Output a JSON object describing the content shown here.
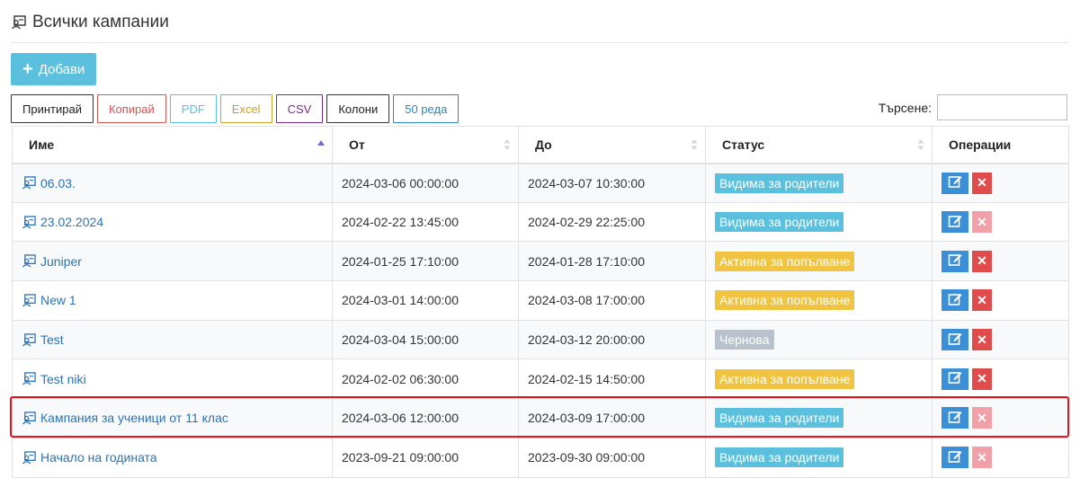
{
  "header": {
    "title": "Всички кампании"
  },
  "toolbar": {
    "add_label": "Добави",
    "buttons": [
      "Принтирай",
      "Копирай",
      "PDF",
      "Excel",
      "CSV",
      "Колони",
      "50 реда"
    ]
  },
  "search": {
    "label": "Търсене:",
    "value": ""
  },
  "table": {
    "columns": [
      "Име",
      "От",
      "До",
      "Статус",
      "Операции"
    ],
    "rows": [
      {
        "name": "06.03.",
        "from": "2024-03-06 00:00:00",
        "to": "2024-03-07 10:30:00",
        "status": "Видима за родители",
        "delete_enabled": true
      },
      {
        "name": "23.02.2024",
        "from": "2024-02-22 13:45:00",
        "to": "2024-02-29 22:25:00",
        "status": "Видима за родители",
        "delete_enabled": false
      },
      {
        "name": "Juniper",
        "from": "2024-01-25 17:10:00",
        "to": "2024-01-28 17:10:00",
        "status": "Активна за попълване",
        "delete_enabled": true
      },
      {
        "name": "New 1",
        "from": "2024-03-01 14:00:00",
        "to": "2024-03-08 17:00:00",
        "status": "Активна за попълване",
        "delete_enabled": true
      },
      {
        "name": "Test",
        "from": "2024-03-04 15:00:00",
        "to": "2024-03-12 20:00:00",
        "status": "Чернова",
        "delete_enabled": true
      },
      {
        "name": "Test niki",
        "from": "2024-02-02 06:30:00",
        "to": "2024-02-15 14:50:00",
        "status": "Активна за попълване",
        "delete_enabled": true
      },
      {
        "name": "Кампания за ученици от 11 клас",
        "from": "2024-03-06 12:00:00",
        "to": "2024-03-09 17:00:00",
        "status": "Видима за родители",
        "delete_enabled": false
      },
      {
        "name": "Начало на годината",
        "from": "2023-09-21 09:00:00",
        "to": "2023-09-30 09:00:00",
        "status": "Видима за родители",
        "delete_enabled": false
      }
    ]
  },
  "status_colors": {
    "Видима за родители": "#5bc0de",
    "Активна за попълване": "#f0c340",
    "Чернова": "#b8c1cc"
  },
  "colors": {
    "delete_active": "#e04b4b",
    "delete_disabled": "#f0a0a6",
    "edit": "#3a8fd6",
    "highlight": "#e8141d"
  },
  "icons": {
    "row_icon": "campaign-icon",
    "edit_icon": "edit-icon",
    "delete_icon": "close-icon"
  }
}
